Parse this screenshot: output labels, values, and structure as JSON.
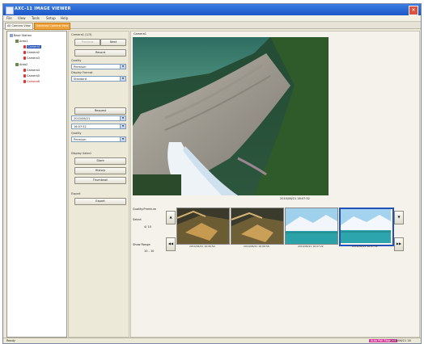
{
  "app": {
    "title": "AXC-11 IMAGE VIEWER",
    "close_glyph": "✕"
  },
  "menu": [
    "File",
    "View",
    "Tools",
    "Setup",
    "Help"
  ],
  "tabs": [
    {
      "label": "All Camera View",
      "active": false
    },
    {
      "label": "Selected Camera View",
      "active": true
    }
  ],
  "tree": {
    "root": "Base Station",
    "areas": [
      {
        "label": "Area1",
        "cameras": [
          "Camera1",
          "Camera2",
          "Camera3"
        ],
        "selected_index": 0
      },
      {
        "label": "Area2",
        "cameras": [
          "Camera4",
          "Camera5",
          "Camera6"
        ],
        "selected_index": -1
      }
    ]
  },
  "controls": {
    "header": "Camera1 (1/3)",
    "prev_label": "Previous",
    "next_label": "Next",
    "record_label": "Record",
    "quality_label": "Quality",
    "quality_value": "Premium",
    "display_format_label": "Display Format",
    "display_format_value": "Standard",
    "request_label": "Request",
    "date_value": "2010/06/21",
    "time_value": "16:07:52",
    "quality2_label": "Quality",
    "quality2_value": "Premium",
    "display_select_label": "Display Select",
    "store_label": "Store",
    "history_label": "History",
    "thumbnail_label": "Thumbnail",
    "export_group_label": "Export",
    "export_label": "Export",
    "dropdown_arrow": "▼"
  },
  "viewer": {
    "camera_label": "Camera1",
    "timestamp": "2010/06/21 16:07:52",
    "quality_text": "Quality:Premium",
    "select_label": "Select",
    "select_value": "4/ 10",
    "range_label": "Show Range",
    "range_value": "10 - 10",
    "nav_up": "▲",
    "nav_down": "▼",
    "nav_prev": "◀◀",
    "nav_next": "▶▶",
    "thumbnails": [
      {
        "time": "2010/06/21 16:06:50",
        "selected": false
      },
      {
        "time": "2010/06/21 16:06:56",
        "selected": false
      },
      {
        "time": "2010/06/21 16:07:22",
        "selected": false
      },
      {
        "time": "2010/06/21 16:07:52",
        "selected": true
      }
    ]
  },
  "status": {
    "left": "Ready",
    "alert": "Auto Poll Stopped",
    "time": "2010/06/21 16"
  },
  "colors": {
    "accent": "#f0a23a",
    "selection": "#2451b6",
    "titlebar": "#1b56c8",
    "alert": "#d83a9b"
  }
}
